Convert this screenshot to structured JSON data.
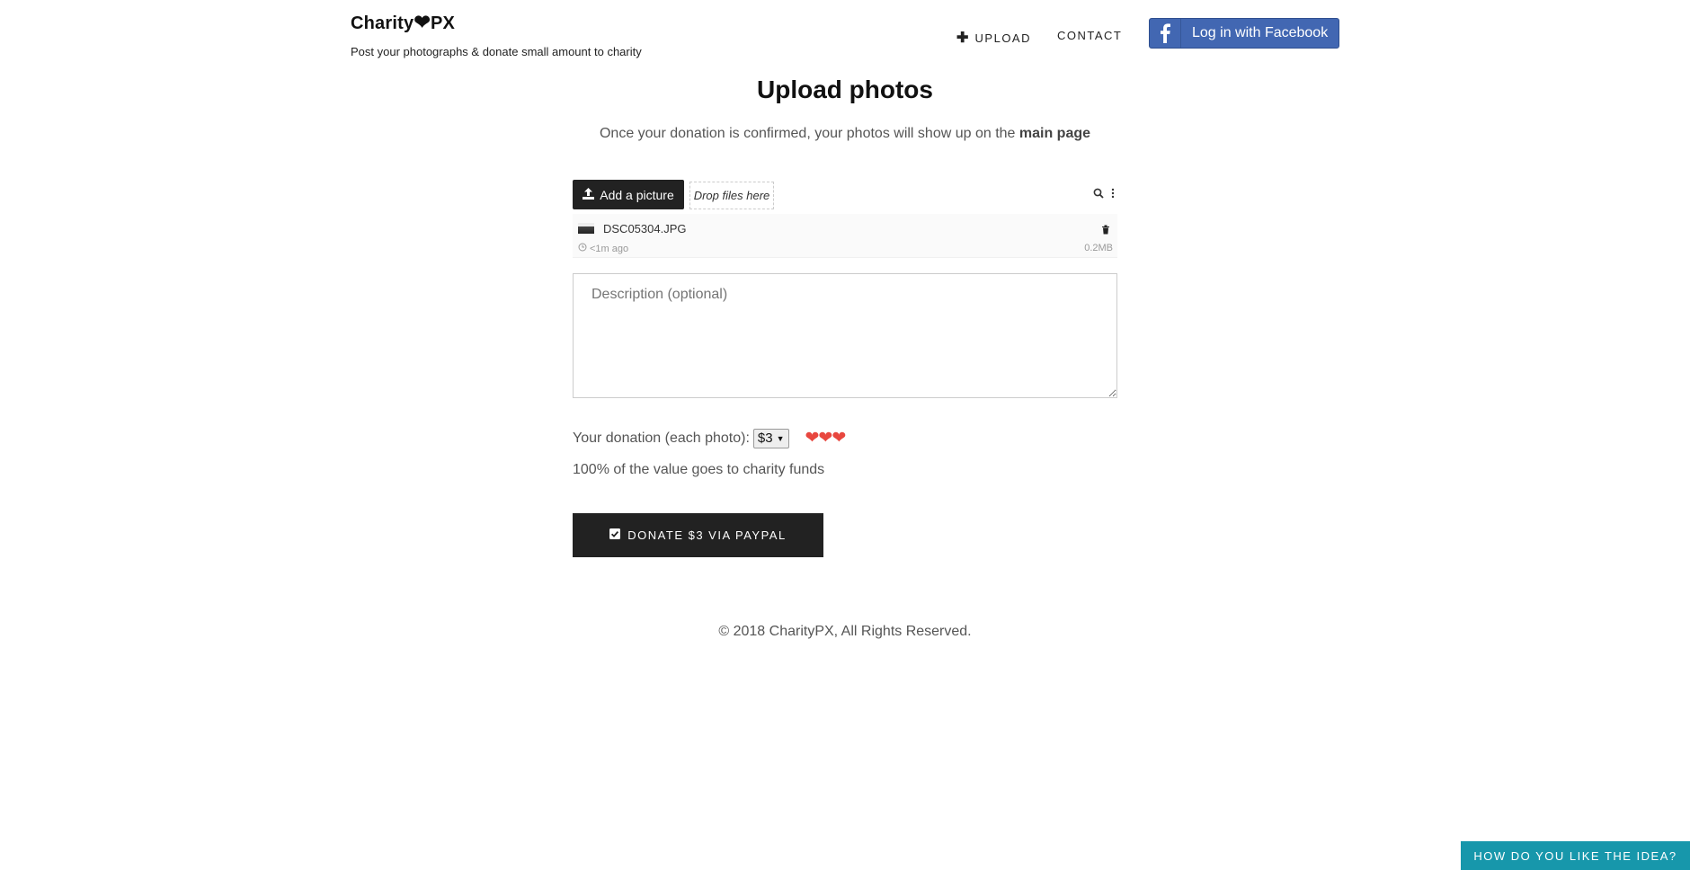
{
  "header": {
    "logo_left": "Charity",
    "logo_right": "PX",
    "tagline": "Post your photographs & donate small amount to charity",
    "nav": {
      "upload": "UPLOAD",
      "contact": "CONTACT"
    },
    "facebook_login": "Log in with Facebook"
  },
  "main": {
    "title": "Upload photos",
    "subtitle_prefix": "Once your donation is confirmed, your photos will show up on the ",
    "subtitle_link": "main page",
    "uploader": {
      "add_button": "Add a picture",
      "drop_zone": "Drop files here",
      "files": [
        {
          "name": "DSC05304.JPG",
          "time": "<1m ago",
          "size": "0.2MB"
        }
      ]
    },
    "description_placeholder": "Description (optional)",
    "donation": {
      "label": "Your donation (each photo):",
      "selected": "$3",
      "hearts": "❤❤❤"
    },
    "charity_note": "100% of the value goes to charity funds",
    "donate_button": "DONATE $3 VIA PAYPAL"
  },
  "footer": {
    "copyright": "© 2018 CharityPX, All Rights Reserved."
  },
  "feedback_button": "HOW DO YOU LIKE THE IDEA?",
  "colors": {
    "facebook": "#4267b2",
    "feedback": "#1797ab",
    "hearts": "#e8473f",
    "dark_button": "#222222"
  }
}
